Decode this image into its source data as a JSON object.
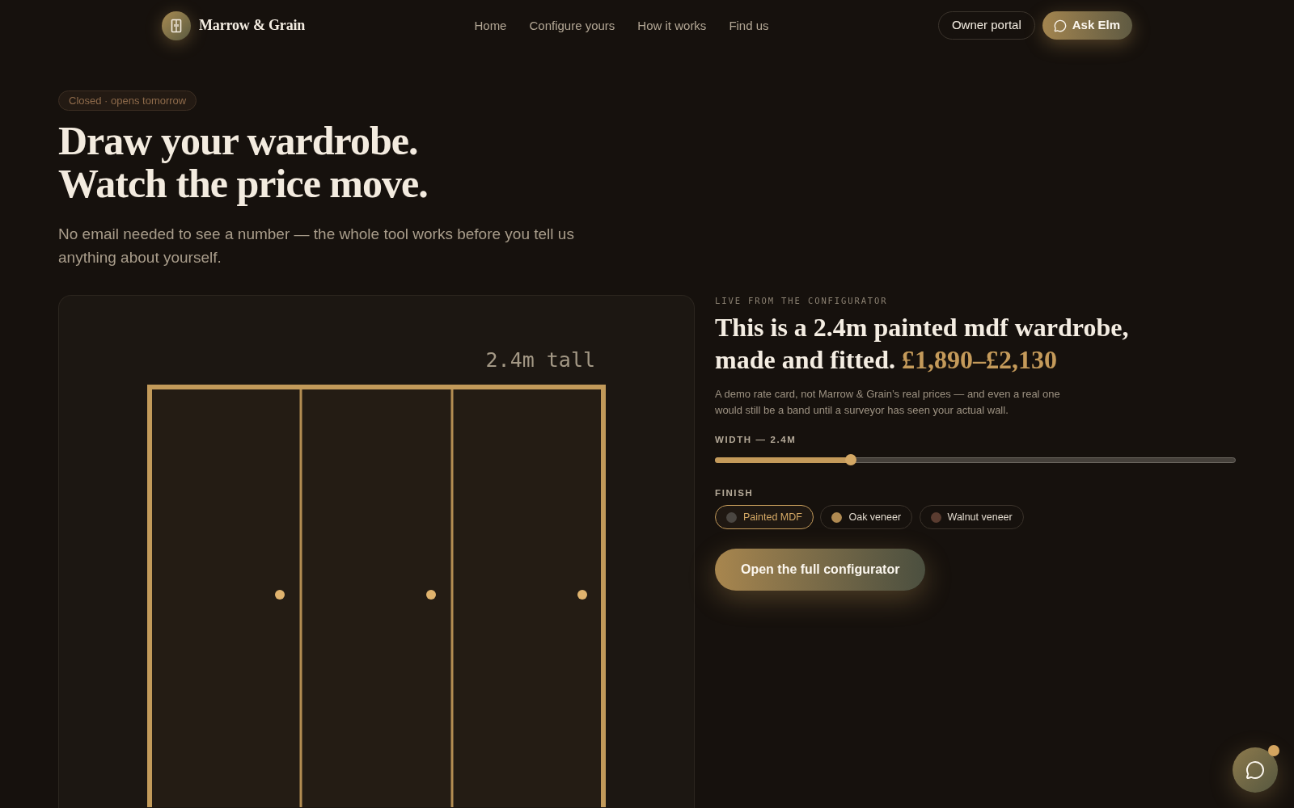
{
  "header": {
    "brand": "Marrow & Grain",
    "nav": [
      {
        "label": "Home"
      },
      {
        "label": "Configure yours"
      },
      {
        "label": "How it works"
      },
      {
        "label": "Find us"
      }
    ],
    "actions": [
      {
        "label": "Owner portal",
        "kind": "portal"
      },
      {
        "label": "Ask Elm",
        "kind": "assistant"
      }
    ]
  },
  "hero": {
    "status": "Closed · opens tomorrow",
    "title": "Draw your wardrobe. Watch the price move.",
    "subtitle": "No email needed to see a number — the whole tool works before you tell us anything about yourself."
  },
  "preview": {
    "height_label": "2.4m tall"
  },
  "configurator": {
    "eyebrow": "LIVE FROM THE CONFIGURATOR",
    "headline": "This is a 2.4m painted mdf wardrobe, made and fitted.",
    "price": "£1,890–£2,130",
    "note": "A demo rate card, not Marrow & Grain’s real prices — and even a real one would still be a band until a surveyor has seen your actual wall.",
    "width": {
      "label": "WIDTH — 2.4M",
      "level": 0.26
    },
    "finish": {
      "label": "FINISH",
      "options": [
        {
          "label": "Painted MDF",
          "color": "#4a4641",
          "selected": true
        },
        {
          "label": "Oak veneer",
          "color": "#b08a52",
          "selected": false
        },
        {
          "label": "Walnut veneer",
          "color": "#5a3c30",
          "selected": false
        }
      ]
    },
    "cta": "Open the full configurator"
  },
  "chat_launcher": {
    "unread": true
  }
}
